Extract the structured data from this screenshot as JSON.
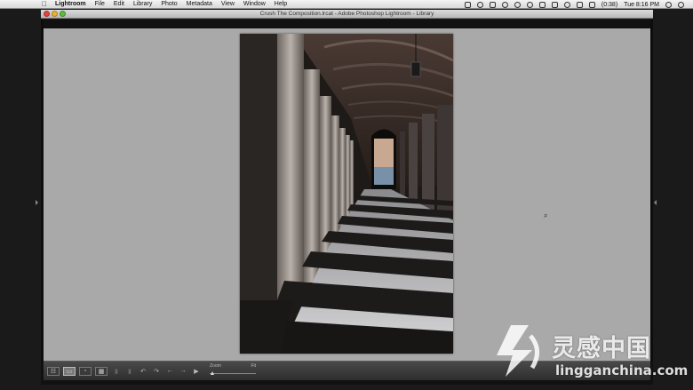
{
  "menubar": {
    "apple": "",
    "items": [
      "Lightroom",
      "File",
      "Edit",
      "Library",
      "Photo",
      "Metadata",
      "View",
      "Window",
      "Help"
    ],
    "battery": "(0:38)",
    "clock": "Tue 8:16 PM"
  },
  "window": {
    "title": "Crush The Composition.lrcat - Adobe Photoshop Lightroom - Library"
  },
  "toolbar": {
    "zoom_label": "Zoom",
    "zoom_fit": "Fit",
    "zoom_level": 0.0
  },
  "watermark": {
    "cn": "灵感中国",
    "en": "lingganchina.com"
  },
  "colors": {
    "workspace_bg": "#a9a9a9",
    "toolbar_bg": "#3a3a3a",
    "desktop_bg": "#1a1a1a"
  }
}
